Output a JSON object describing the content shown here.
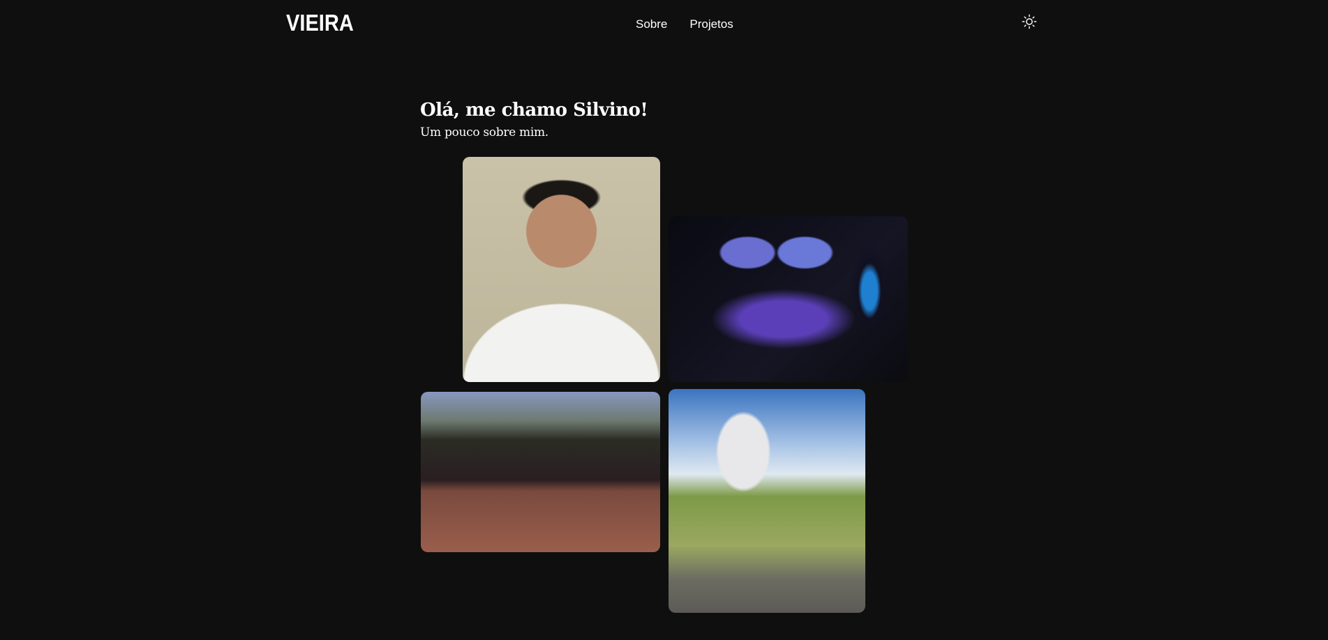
{
  "header": {
    "logo": "VIEIRA",
    "nav": [
      {
        "label": "Sobre"
      },
      {
        "label": "Projetos"
      }
    ],
    "theme_toggle_icon": "sun-icon"
  },
  "intro": {
    "title": "Olá, me chamo Silvino!",
    "subtitle": "Um pouco sobre mim."
  },
  "colors": {
    "background": "#0f0f0f",
    "text": "#ffffff"
  }
}
